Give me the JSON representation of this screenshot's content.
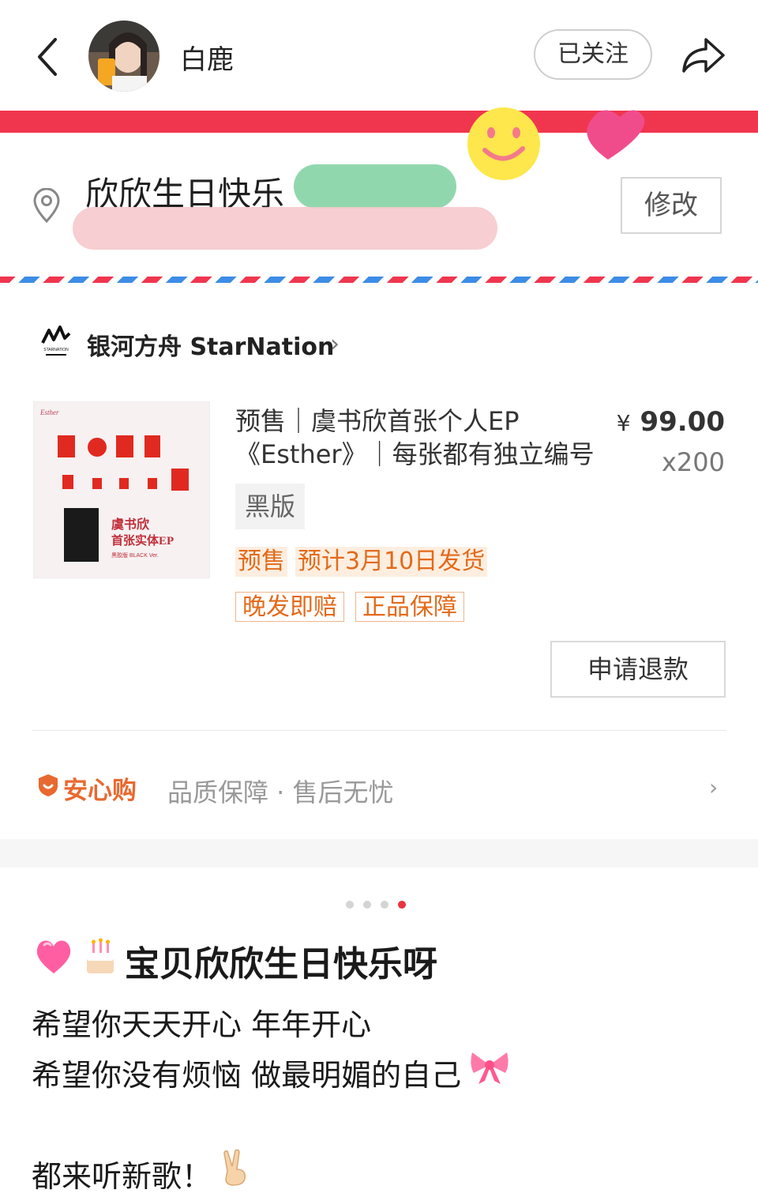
{
  "header": {
    "username": "白鹿",
    "follow_label": "已关注"
  },
  "address": {
    "text": "欣欣生日快乐",
    "edit_label": "修改"
  },
  "store": {
    "name": "银河方舟 StarNation",
    "logo_text": "STARNATION",
    "chevron": "›"
  },
  "product": {
    "title": "预售｜虞书欣首张个人EP《Esther》｜每张都有独立编号",
    "price_symbol": "¥",
    "price": "99.00",
    "quantity": "x200",
    "variant": "黑版",
    "tags": [
      "预售",
      "预计3月10日发货"
    ],
    "badges": [
      "晚发即赔",
      "正品保障"
    ],
    "refund_label": "申请退款",
    "image_text": {
      "line1": "虞书欣",
      "line2": "首张实体EP",
      "line3": "黑胶版 BLACK Ver."
    }
  },
  "guarantee": {
    "name": "安心购",
    "desc": "品质保障 · 售后无忧",
    "chevron": "›"
  },
  "pagination": {
    "count": 4,
    "active_index": 3
  },
  "post": {
    "title": "宝贝欣欣生日快乐呀",
    "lines": [
      "希望你天天开心 年年开心",
      "希望你没有烦恼 做最明媚的自己",
      "都来听新歌！"
    ]
  },
  "colors": {
    "accent_red": "#f0364f",
    "stripe_blue": "#3d8ce6",
    "tag_orange": "#e36a1a",
    "guarantee_orange": "#e8692f"
  }
}
